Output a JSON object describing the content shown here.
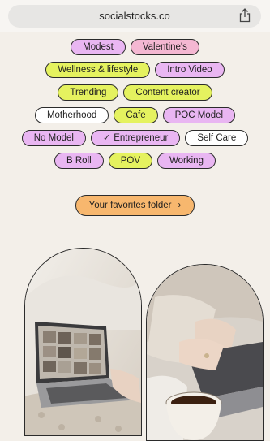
{
  "browser": {
    "url": "socialstocks.co"
  },
  "tags": [
    [
      {
        "label": "Modest",
        "color": "purple"
      },
      {
        "label": "Valentine's",
        "color": "pink"
      }
    ],
    [
      {
        "label": "Wellness & lifestyle",
        "color": "yellow"
      },
      {
        "label": "Intro Video",
        "color": "purple"
      }
    ],
    [
      {
        "label": "Trending",
        "color": "yellow"
      },
      {
        "label": "Content creator",
        "color": "yellow"
      }
    ],
    [
      {
        "label": "Motherhood",
        "color": "white"
      },
      {
        "label": "Cafe",
        "color": "yellow"
      },
      {
        "label": "POC Model",
        "color": "purple"
      }
    ],
    [
      {
        "label": "No Model",
        "color": "purple"
      },
      {
        "label": "Entrepreneur",
        "color": "purple",
        "selected": true
      },
      {
        "label": "Self Care",
        "color": "white"
      }
    ],
    [
      {
        "label": "B Roll",
        "color": "purple"
      },
      {
        "label": "POV",
        "color": "yellow"
      },
      {
        "label": "Working",
        "color": "purple"
      }
    ]
  ],
  "favorites_button": {
    "label": "Your favorites folder"
  },
  "colors": {
    "purple": "#e9b6f2",
    "pink": "#f4b7d2",
    "yellow": "#e5f25f",
    "white": "#ffffff",
    "orange": "#f7b76e",
    "background": "#f3efe9"
  },
  "icons": {
    "share": "share-icon",
    "check": "checkmark-icon",
    "chevron": "chevron-right-icon"
  }
}
